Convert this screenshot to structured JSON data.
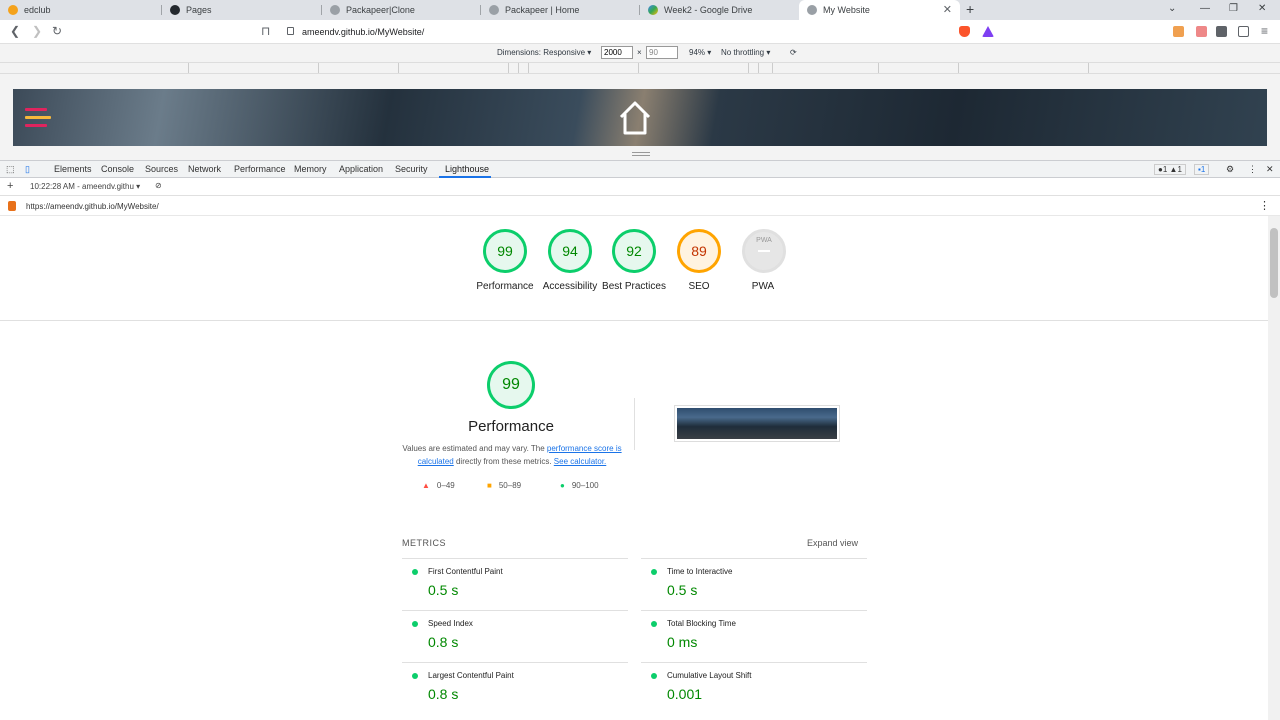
{
  "tabs": [
    {
      "title": "edclub",
      "color": "#f4a21b"
    },
    {
      "title": "Pages",
      "color": "#24292e"
    },
    {
      "title": "Packapeer|Clone",
      "color": "#5f6368"
    },
    {
      "title": "Packapeer | Home",
      "color": "#5f6368"
    },
    {
      "title": "Week2 - Google Drive",
      "color": "#34a853"
    },
    {
      "title": "My Website",
      "color": "#5f6368"
    }
  ],
  "address": {
    "url": "ameendv.github.io/MyWebsite/"
  },
  "device_toolbar": {
    "dimensions_label": "Dimensions: Responsive",
    "width_value": "2000",
    "x": "×",
    "height_value": "90",
    "zoom": "94%",
    "throttling": "No throttling"
  },
  "devtools": {
    "tabs": [
      "Elements",
      "Console",
      "Sources",
      "Network",
      "Performance",
      "Memory",
      "Application",
      "Security",
      "Lighthouse"
    ],
    "active_tab": "Lighthouse",
    "badges": {
      "errors": "1",
      "warnings": "1",
      "messages": "1"
    }
  },
  "lighthouse": {
    "report_selector": "10:22:28 AM - ameendv.githu",
    "report_url": "https://ameendv.github.io/MyWebsite/"
  },
  "scores": [
    {
      "value": "99",
      "label": "Performance",
      "rating": "pass"
    },
    {
      "value": "94",
      "label": "Accessibility",
      "rating": "pass"
    },
    {
      "value": "92",
      "label": "Best Practices",
      "rating": "pass"
    },
    {
      "value": "89",
      "label": "SEO",
      "rating": "average"
    },
    {
      "value": "PWA",
      "label": "PWA",
      "rating": "na"
    }
  ],
  "performance": {
    "score": "99",
    "title": "Performance",
    "desc_prefix": "Values are estimated and may vary. The ",
    "desc_link1": "performance score is calculated",
    "desc_middle": " directly from these metrics. ",
    "desc_link2": "See calculator.",
    "legend": [
      {
        "range": "0–49",
        "symbol": "▲",
        "color": "#ff4e42"
      },
      {
        "range": "50–89",
        "symbol": "■",
        "color": "#ffa400"
      },
      {
        "range": "90–100",
        "symbol": "●",
        "color": "#0cce6b"
      }
    ]
  },
  "metrics": {
    "heading": "METRICS",
    "expand_label": "Expand view",
    "items": [
      {
        "name": "First Contentful Paint",
        "value": "0.5 s"
      },
      {
        "name": "Time to Interactive",
        "value": "0.5 s"
      },
      {
        "name": "Speed Index",
        "value": "0.8 s"
      },
      {
        "name": "Total Blocking Time",
        "value": "0 ms"
      },
      {
        "name": "Largest Contentful Paint",
        "value": "0.8 s"
      },
      {
        "name": "Cumulative Layout Shift",
        "value": "0.001"
      }
    ]
  }
}
